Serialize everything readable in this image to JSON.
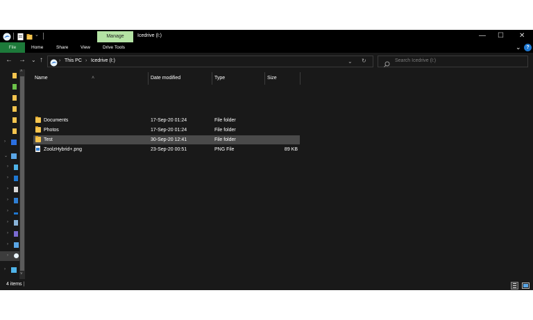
{
  "titlebar": {
    "manage_label": "Manage",
    "title": "Icedrive (I:)",
    "minimize": "—",
    "maximize": "☐",
    "close": "✕"
  },
  "ribbon": {
    "tabs": [
      "File",
      "Home",
      "Share",
      "View",
      "Drive Tools"
    ],
    "expand": "⌄",
    "help": "?"
  },
  "address": {
    "back": "←",
    "forward": "→",
    "recent": "⌄",
    "up": "↑",
    "crumbs": [
      "This PC",
      "Icedrive (I:)"
    ],
    "separator": "›",
    "dropdown": "⌄",
    "refresh": "↻",
    "search_placeholder": "Search Icedrive (I:)"
  },
  "columns": {
    "name": "Name",
    "date": "Date modified",
    "type": "Type",
    "size": "Size"
  },
  "files": [
    {
      "name": "Documents",
      "date": "17-Sep-20 01:24",
      "type": "File folder",
      "size": "",
      "icon": "folder-icon"
    },
    {
      "name": "Photos",
      "date": "17-Sep-20 01:24",
      "type": "File folder",
      "size": "",
      "icon": "folder-icon"
    },
    {
      "name": "Test",
      "date": "30-Sep-20 12:41",
      "type": "File folder",
      "size": "",
      "icon": "folder-icon",
      "selected": true
    },
    {
      "name": "ZoolzHybrid+.png",
      "date": "23-Sep-20 00:51",
      "type": "PNG File",
      "size": "89 KB",
      "icon": "png-icon"
    }
  ],
  "status": {
    "items": "4 items"
  },
  "colors": {
    "background": "#191919",
    "manage_tab": "#b4e3a4",
    "file_tab": "#1d7a3a",
    "selected_row": "#4a4a4a",
    "folder": "#f4c44e"
  }
}
